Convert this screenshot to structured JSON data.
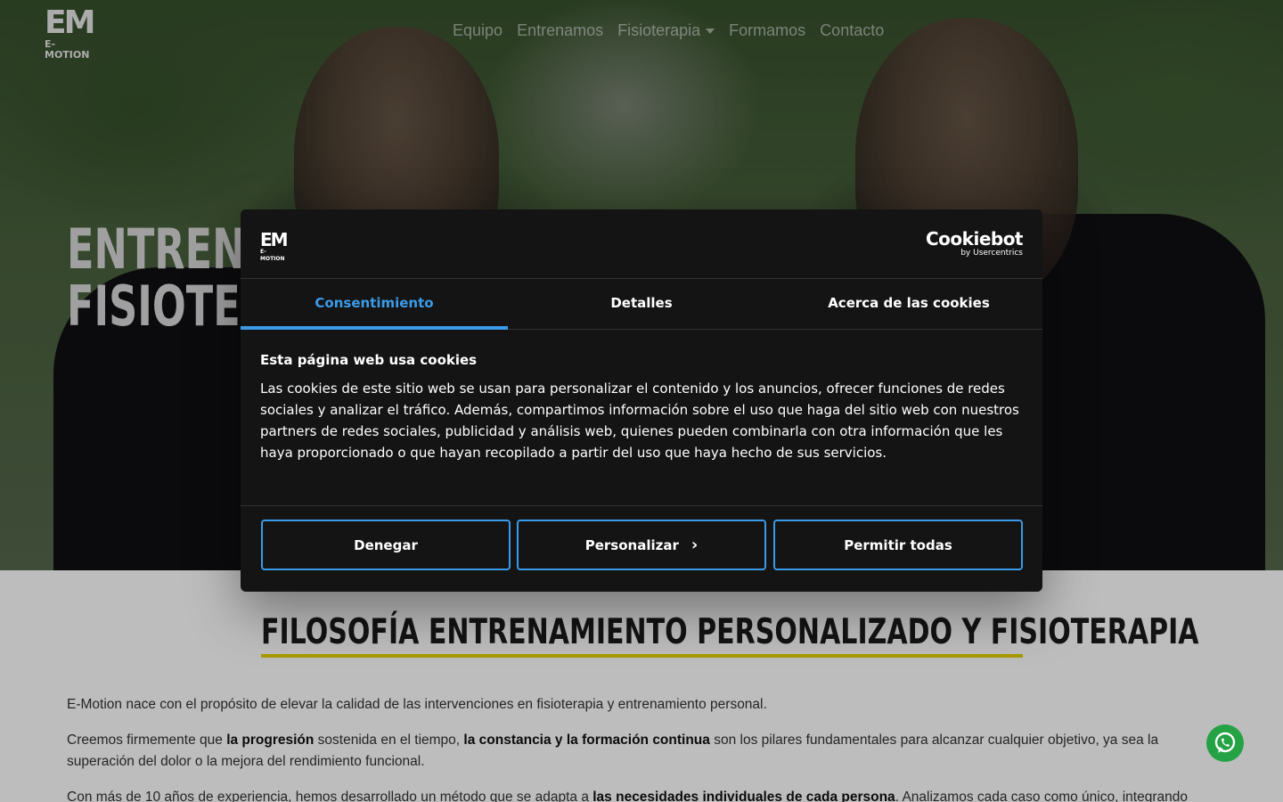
{
  "brand": {
    "logo_mark": "EM",
    "logo_text": "E-MOTION"
  },
  "nav": {
    "items": [
      {
        "label": "Equipo"
      },
      {
        "label": "Entrenamos"
      },
      {
        "label": "Fisioterapia"
      },
      {
        "label": "Formamos"
      },
      {
        "label": "Contacto"
      }
    ]
  },
  "hero": {
    "title_line1": "ENTREN",
    "title_line2": "FISIOTE"
  },
  "main": {
    "section_title": "FILOSOFÍA ENTRENAMIENTO PERSONALIZADO Y FISIOTERAPIA",
    "p1": "E-Motion nace con el propósito de elevar la calidad de las intervenciones en fisioterapia y entrenamiento personal.",
    "p2_a": "Creemos firmemente que ",
    "p2_b": "la progresión",
    "p2_c": " sostenida en el tiempo, ",
    "p2_d": "la constancia y la formación continua",
    "p2_e": " son los pilares fundamentales para alcanzar cualquier objetivo, ya sea la superación del dolor o la mejora del rendimiento funcional.",
    "p3_a": "Con más de 10 años de experiencia, hemos desarrollado un método que se adapta a ",
    "p3_b": "las necesidades individuales de cada persona",
    "p3_c": ". Analizamos cada caso como único, integrando"
  },
  "cookie_dialog": {
    "logo_mark": "EM",
    "logo_text": "E-MOTION",
    "provider_name": "Cookiebot",
    "provider_by": "by Usercentrics",
    "tabs": [
      {
        "label": "Consentimiento"
      },
      {
        "label": "Detalles"
      },
      {
        "label": "Acerca de las cookies"
      }
    ],
    "heading": "Esta página web usa cookies",
    "text": "Las cookies de este sitio web se usan para personalizar el contenido y los anuncios, ofrecer funciones de redes sociales y analizar el tráfico. Además, compartimos información sobre el uso que haga del sitio web con nuestros partners de redes sociales, publicidad y análisis web, quienes pueden combinarla con otra información que les haya proporcionado o que hayan recopilado a partir del uso que haya hecho de sus servicios.",
    "buttons": {
      "deny": "Denegar",
      "customize": "Personalizar",
      "allow_all": "Permitir todas"
    }
  },
  "icons": {
    "whatsapp": "whatsapp-icon",
    "dropdown": "chevron-down-icon",
    "customize_chevron": "chevron-right-icon"
  },
  "colors": {
    "accent": "#3b9be8",
    "title_underline": "#e3d000",
    "whatsapp": "#25a244",
    "dialog_bg": "#141414"
  }
}
